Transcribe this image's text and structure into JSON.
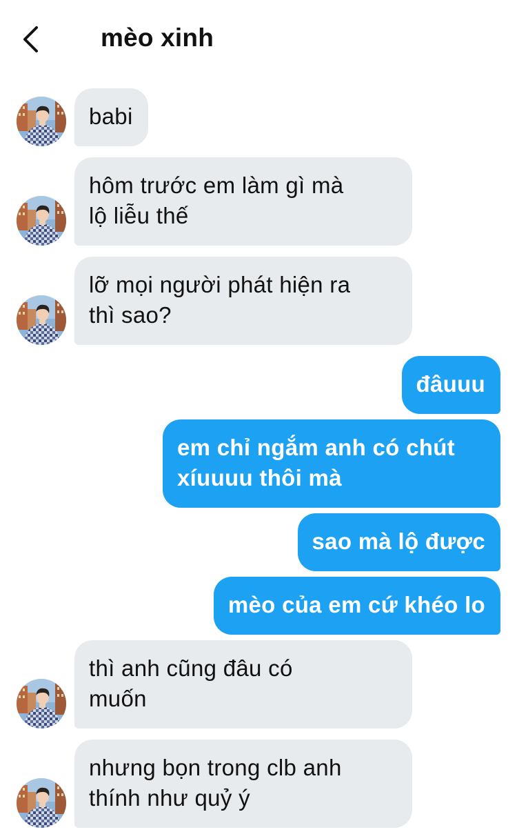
{
  "header": {
    "title": "mèo xinh",
    "back_icon": "chevron-left-icon"
  },
  "contact": {
    "avatar_icon": "profile-photo-avatar"
  },
  "colors": {
    "sent_bubble": "#1da1f2",
    "received_bubble": "#e7ebee",
    "text_dark": "#111111"
  },
  "messages": [
    {
      "sender": "contact",
      "text": "babi"
    },
    {
      "sender": "contact",
      "text": "hôm trước em làm gì mà\nlộ liễu thế"
    },
    {
      "sender": "contact",
      "text": "lỡ mọi người phát hiện ra\nthì sao?"
    },
    {
      "sender": "me",
      "text": "đâuuu"
    },
    {
      "sender": "me",
      "text": "em chỉ ngắm anh có chút\nxíuuuu thôi mà"
    },
    {
      "sender": "me",
      "text": "sao mà lộ được"
    },
    {
      "sender": "me",
      "text": "mèo của em cứ khéo lo"
    },
    {
      "sender": "contact",
      "text": "thì anh cũng đâu có\nmuốn"
    },
    {
      "sender": "contact",
      "text": "nhưng bọn trong clb anh\nthính như quỷ ý"
    }
  ]
}
